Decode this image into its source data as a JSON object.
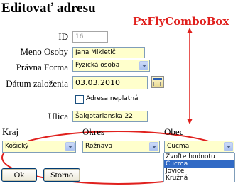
{
  "page": {
    "title": "Editovať adresu",
    "annotation": "PxFlyComboBox"
  },
  "form": {
    "id": {
      "label": "ID",
      "value": "16"
    },
    "meno_osoby": {
      "label": "Meno Osoby",
      "value": "Jana Mikletič"
    },
    "pravna_forma": {
      "label": "Právna Forma",
      "value": "Fyzická osoba"
    },
    "datum_zalozenia": {
      "label": "Dátum založenia",
      "value": "03.03.2010"
    },
    "adresa_neplatna": {
      "label": "Adresa neplatná",
      "checked": false
    },
    "ulica": {
      "label": "Ulica",
      "value": "Šalgotarianska 22"
    }
  },
  "location": {
    "kraj": {
      "label": "Kraj",
      "value": "Košický"
    },
    "okres": {
      "label": "Okres",
      "value": "Rožnava"
    },
    "obec": {
      "label": "Obec",
      "value": "Cucma",
      "options": [
        "Zvoľte hodnotu",
        "Cucma",
        "Jovice",
        "Kružná"
      ],
      "selected_index": 1
    }
  },
  "buttons": {
    "ok": "Ok",
    "storno": "Storno"
  },
  "colors": {
    "field_bg": "#ffffcc",
    "annotation": "#e0201d",
    "selection": "#316ac5"
  }
}
